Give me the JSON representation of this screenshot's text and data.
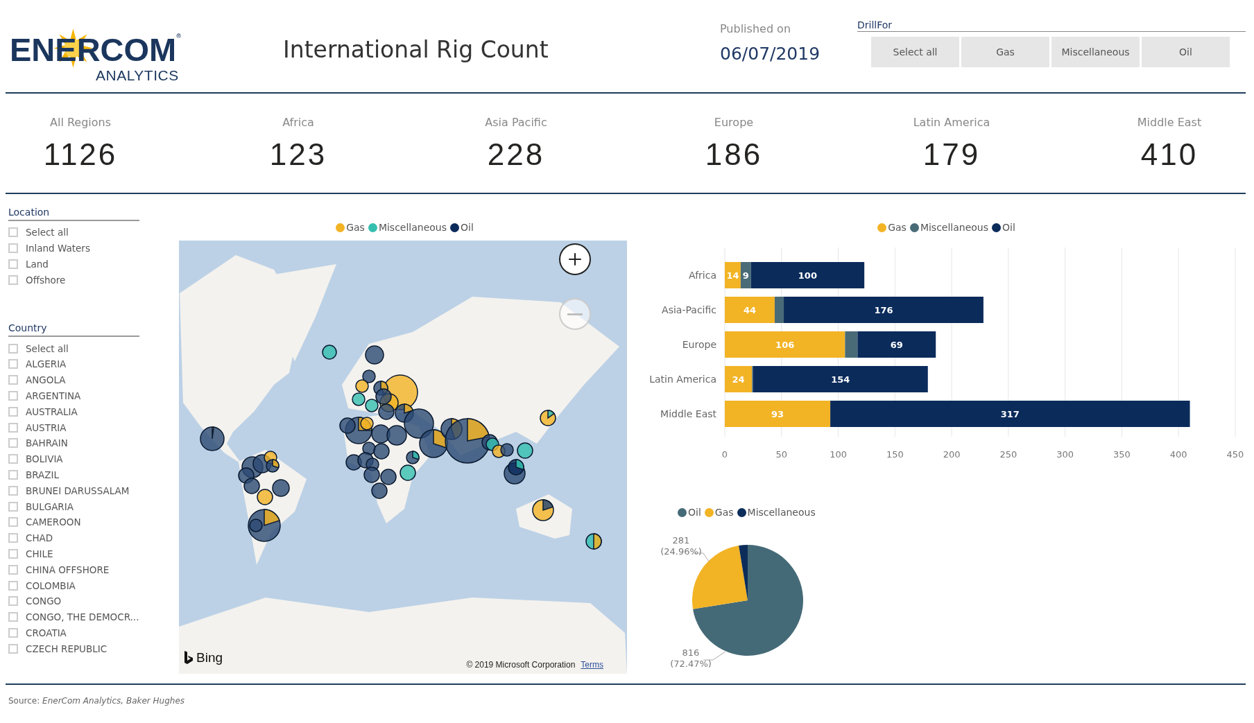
{
  "header": {
    "logo": {
      "name": "ENERCOM$^{®}$",
      "tagline": "ANALYTICS"
    },
    "title": "International Rig Count",
    "published_label": "Published on",
    "published_date": "06/07/2019",
    "drill_for": {
      "label": "DrillFor",
      "buttons": [
        {
          "label": "Select all",
          "selected": false
        },
        {
          "label": "Gas",
          "selected": false
        },
        {
          "label": "Miscellaneous",
          "selected": false
        },
        {
          "label": "Oil",
          "selected": false
        }
      ]
    }
  },
  "kpis": [
    {
      "label": "All Regions",
      "value": "1126"
    },
    {
      "label": "Africa",
      "value": "123"
    },
    {
      "label": "Asia Pacific",
      "value": "228"
    },
    {
      "label": "Europe",
      "value": "186"
    },
    {
      "label": "Latin America",
      "value": "179"
    },
    {
      "label": "Middle East",
      "value": "410"
    }
  ],
  "location_filter": {
    "title": "Location",
    "items": [
      {
        "label": "Select all",
        "checked": false
      },
      {
        "label": "Inland Waters",
        "checked": false
      },
      {
        "label": "Land",
        "checked": false
      },
      {
        "label": "Offshore",
        "checked": false
      }
    ]
  },
  "country_filter": {
    "title": "Country",
    "items": [
      {
        "label": "Select all",
        "checked": false
      },
      {
        "label": "ALGERIA",
        "checked": false
      },
      {
        "label": "ANGOLA",
        "checked": false
      },
      {
        "label": "ARGENTINA",
        "checked": false
      },
      {
        "label": "AUSTRALIA",
        "checked": false
      },
      {
        "label": "AUSTRIA",
        "checked": false
      },
      {
        "label": "BAHRAIN",
        "checked": false
      },
      {
        "label": "BOLIVIA",
        "checked": false
      },
      {
        "label": "BRAZIL",
        "checked": false
      },
      {
        "label": "BRUNEI DARUSSALAM",
        "checked": false
      },
      {
        "label": "BULGARIA",
        "checked": false
      },
      {
        "label": "CAMEROON",
        "checked": false
      },
      {
        "label": "CHAD",
        "checked": false
      },
      {
        "label": "CHILE",
        "checked": false
      },
      {
        "label": "CHINA OFFSHORE",
        "checked": false
      },
      {
        "label": "COLOMBIA",
        "checked": false
      },
      {
        "label": "CONGO",
        "checked": false
      },
      {
        "label": "CONGO, THE DEMOCR...",
        "checked": false
      },
      {
        "label": "CROATIA",
        "checked": false
      },
      {
        "label": "CZECH REPUBLIC",
        "checked": false
      }
    ]
  },
  "map": {
    "legend": [
      {
        "label": "Gas",
        "color": "#f2b325"
      },
      {
        "label": "Miscellaneous",
        "color": "#35bfb0"
      },
      {
        "label": "Oil",
        "color": "#0b2b5b"
      }
    ],
    "zoom_in_disabled": false,
    "zoom_out_disabled": true,
    "provider": "Bing",
    "attribution": "© 2019 Microsoft Corporation",
    "terms_link": "Terms"
  },
  "bar_chart": {
    "chart_data": {
      "type": "bar",
      "orientation": "horizontal",
      "stacked": true,
      "grid": true,
      "categories": [
        "Africa",
        "Asia-Pacific",
        "Europe",
        "Latin America",
        "Middle East"
      ],
      "series": [
        {
          "name": "Gas",
          "color": "#f2b325",
          "values": [
            14,
            44,
            106,
            24,
            93
          ]
        },
        {
          "name": "Miscellaneous",
          "color": "#496b77",
          "values": [
            9,
            8,
            11,
            1,
            0
          ]
        },
        {
          "name": "Oil",
          "color": "#0b2b5b",
          "values": [
            100,
            176,
            69,
            154,
            317
          ]
        }
      ],
      "xlim": [
        0,
        450
      ],
      "xticks": [
        0,
        50,
        100,
        150,
        200,
        250,
        300,
        350,
        400,
        450
      ],
      "value_labels": [
        [
          "14",
          "44",
          "106",
          "24",
          "93"
        ],
        [
          "9",
          null,
          null,
          null,
          null
        ],
        [
          "100",
          "176",
          "69",
          "154",
          "317"
        ]
      ]
    }
  },
  "pie_chart": {
    "slices": [
      {
        "color": "#456a77"
      },
      {
        "color": "#f2b325"
      },
      {
        "color": "#0c2d5a"
      }
    ],
    "chart_data": {
      "type": "pie",
      "categories": [
        "Oil",
        "Gas",
        "Miscellaneous"
      ],
      "values": [
        72.47,
        24.96,
        2.57
      ],
      "value_labels": [
        [
          "816",
          "(72.47%)"
        ],
        [
          "281",
          "(24.96%)"
        ],
        null
      ]
    }
  },
  "footer": {
    "source": "Source: *EnerCom Analytics, Baker Hughes*"
  }
}
